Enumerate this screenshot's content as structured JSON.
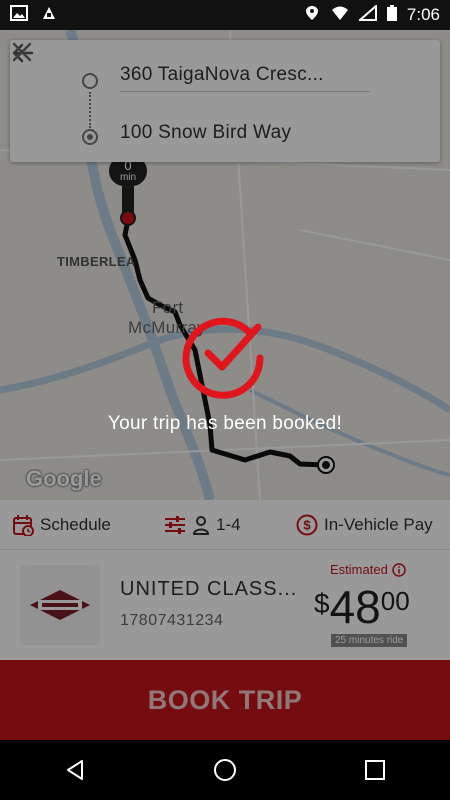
{
  "status_bar": {
    "time": "7:06",
    "left_icons": [
      "image-icon",
      "fake-gps-icon"
    ],
    "right_icons": [
      "location-icon",
      "wifi-icon",
      "cell-signal-icon",
      "battery-icon"
    ]
  },
  "search": {
    "from": "360 TaigaNova Cresc...",
    "to": "100 Snow Bird Way"
  },
  "map": {
    "labels": [
      "TIMBERLEA",
      "Fort",
      "McMurray"
    ],
    "pin_minutes": "0",
    "pin_unit": "min",
    "attribution": "Google"
  },
  "confirmation": {
    "message": "Your trip has been booked!"
  },
  "options": {
    "schedule": "Schedule",
    "passengers": "1-4",
    "payment": "In-Vehicle Pay"
  },
  "provider": {
    "name": "UNITED CLASS...",
    "phone": "17807431234",
    "estimated_label": "Estimated",
    "currency": "$",
    "price_whole": "48",
    "price_cents": "00",
    "duration": "25 minutes ride"
  },
  "book_button": "BOOK TRIP",
  "colors": {
    "accent": "#c4161c",
    "route": "#111111"
  }
}
